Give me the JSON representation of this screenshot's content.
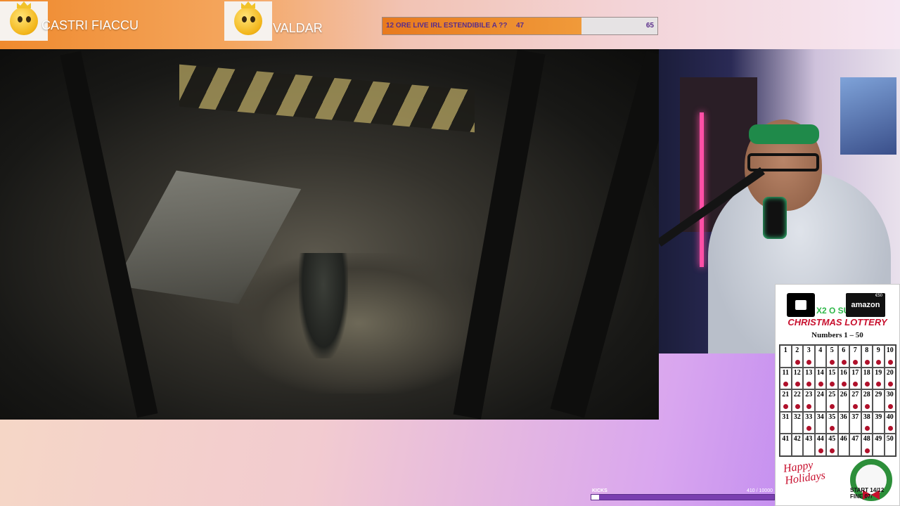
{
  "topbar": {
    "users": [
      {
        "name": "CASTRI FIACCU",
        "icon": "crowned-emoji-icon"
      },
      {
        "name": "VALDAR",
        "icon": "crowned-emoji-trophy-icon"
      }
    ],
    "goal": {
      "label": "12 ORE LIVE IRL ESTENDIBILE A ??",
      "current": "47",
      "target": "65",
      "progress": 0.723
    },
    "accent_color": "#ef8a2e"
  },
  "lottery": {
    "badge_text": "X2 O SUB",
    "amazon_label": "amazon",
    "amazon_price": "€50",
    "title": "CHRISTMAS LOTTERY",
    "subtitle": "Numbers 1 – 50",
    "numbers": [
      "1",
      "2",
      "3",
      "4",
      "5",
      "6",
      "7",
      "8",
      "9",
      "10",
      "11",
      "12",
      "13",
      "14",
      "15",
      "16",
      "17",
      "18",
      "19",
      "20",
      "21",
      "22",
      "23",
      "24",
      "25",
      "26",
      "27",
      "28",
      "29",
      "30",
      "31",
      "32",
      "33",
      "34",
      "35",
      "36",
      "37",
      "38",
      "39",
      "40",
      "41",
      "42",
      "43",
      "44",
      "45",
      "46",
      "47",
      "48",
      "49",
      "50"
    ],
    "marked": [
      2,
      3,
      5,
      6,
      7,
      8,
      9,
      10,
      11,
      12,
      13,
      14,
      15,
      16,
      17,
      18,
      19,
      20,
      21,
      22,
      23,
      25,
      27,
      28,
      30,
      33,
      35,
      38,
      40,
      44,
      45,
      48
    ],
    "greeting_line1": "Happy",
    "greeting_line2": "Holidays",
    "schedule_line1": "START 14/12",
    "schedule_line2": "FINE 07/",
    "accent_color": "#c8102e"
  },
  "kicks": {
    "label": "KICKS",
    "count": "410 / 10000",
    "progress": 0.041
  }
}
